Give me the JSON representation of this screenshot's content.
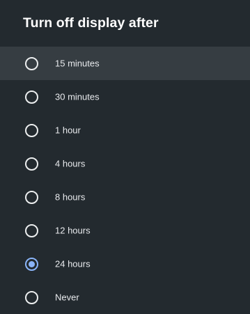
{
  "dialog": {
    "title": "Turn off display after"
  },
  "options": [
    {
      "label": "15 minutes",
      "selected": false,
      "focused": true
    },
    {
      "label": "30 minutes",
      "selected": false,
      "focused": false
    },
    {
      "label": "1 hour",
      "selected": false,
      "focused": false
    },
    {
      "label": "4 hours",
      "selected": false,
      "focused": false
    },
    {
      "label": "8 hours",
      "selected": false,
      "focused": false
    },
    {
      "label": "12 hours",
      "selected": false,
      "focused": false
    },
    {
      "label": "24 hours",
      "selected": true,
      "focused": false
    },
    {
      "label": "Never",
      "selected": false,
      "focused": false
    }
  ],
  "colors": {
    "background": "#232a2f",
    "focused_row": "#363d42",
    "radio_unchecked": "#eceeef",
    "radio_checked": "#8ab4f8",
    "text": "#e8eaed"
  }
}
